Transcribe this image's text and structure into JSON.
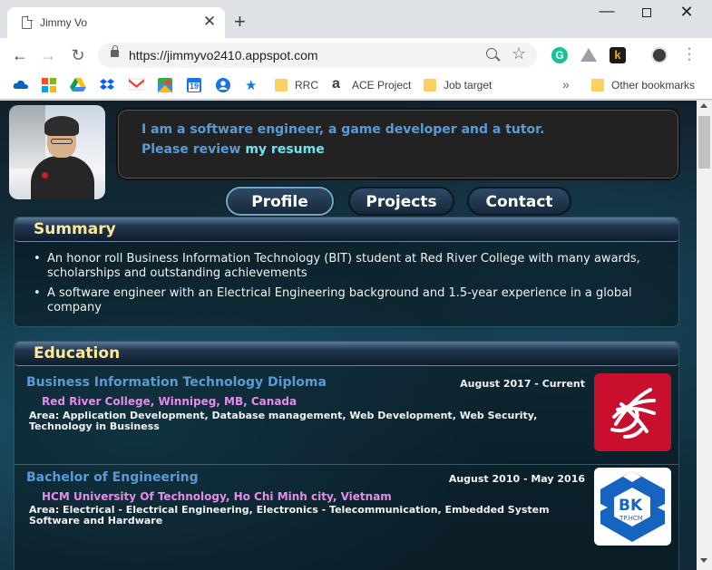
{
  "browser": {
    "tab_title": "Jimmy Vo",
    "tab_close": "✕",
    "new_tab": "+",
    "url": "https://jimmyvo2410.appspot.com",
    "bookmarks": [
      {
        "label": "RRC",
        "icon": "folder-icon"
      },
      {
        "label": "ACE Project",
        "icon": "amazon-icon"
      },
      {
        "label": "Job target",
        "icon": "folder-icon"
      }
    ],
    "bookmark_icons": [
      "onedrive-icon",
      "microsoft-icon",
      "google-drive-icon",
      "dropbox-icon",
      "gmail-icon",
      "google-maps-icon",
      "calendar-icon",
      "account-icon",
      "star-bookmark-icon"
    ],
    "calendar_day": "19",
    "overflow": "»",
    "other_bookmarks": "Other bookmarks",
    "extensions": {
      "grammarly": "G",
      "k": "k"
    }
  },
  "page": {
    "intro_line1": "I am a software engineer, a game developer and a tutor.",
    "intro_line2_prefix": "Please review ",
    "intro_link": "my resume",
    "nav_tabs": [
      "Profile",
      "Projects",
      "Contact"
    ],
    "active_tab": "Profile",
    "summary": {
      "title": "Summary",
      "items": [
        "An honor roll Business Information Technology (BIT) student at Red River College with many awards, scholarships and outstanding achievements",
        "A software engineer with an Electrical Engineering background and 1.5-year experience in a global company"
      ]
    },
    "education": {
      "title": "Education",
      "entries": [
        {
          "degree": "Business Information Technology Diploma",
          "date": "August 2017 - Current",
          "school": "Red River College, Winnipeg, MB, Canada",
          "area": "Area: Application Development, Database management, Web Development, Web Security, Technology in Business",
          "logo": "red-river-college-logo"
        },
        {
          "degree": "Bachelor of Engineering",
          "date": "August 2010 - May 2016",
          "school": "HCM University Of Technology, Ho Chi Minh city, Vietnam",
          "area": "Area: Electrical - Electrical Engineering, Electronics - Telecommunication, Embedded System Software and Hardware",
          "logo": "hcmut-logo",
          "logo_text": "BK",
          "logo_subtext": "TP.HCM"
        }
      ]
    }
  },
  "colors": {
    "accent_blue": "#5b9bd5",
    "link_cyan": "#6ee3f2",
    "school_pink": "#e58be8",
    "section_title_yellow": "#fde99a",
    "rrc_red": "#c8102e",
    "bk_blue": "#1565c0"
  }
}
